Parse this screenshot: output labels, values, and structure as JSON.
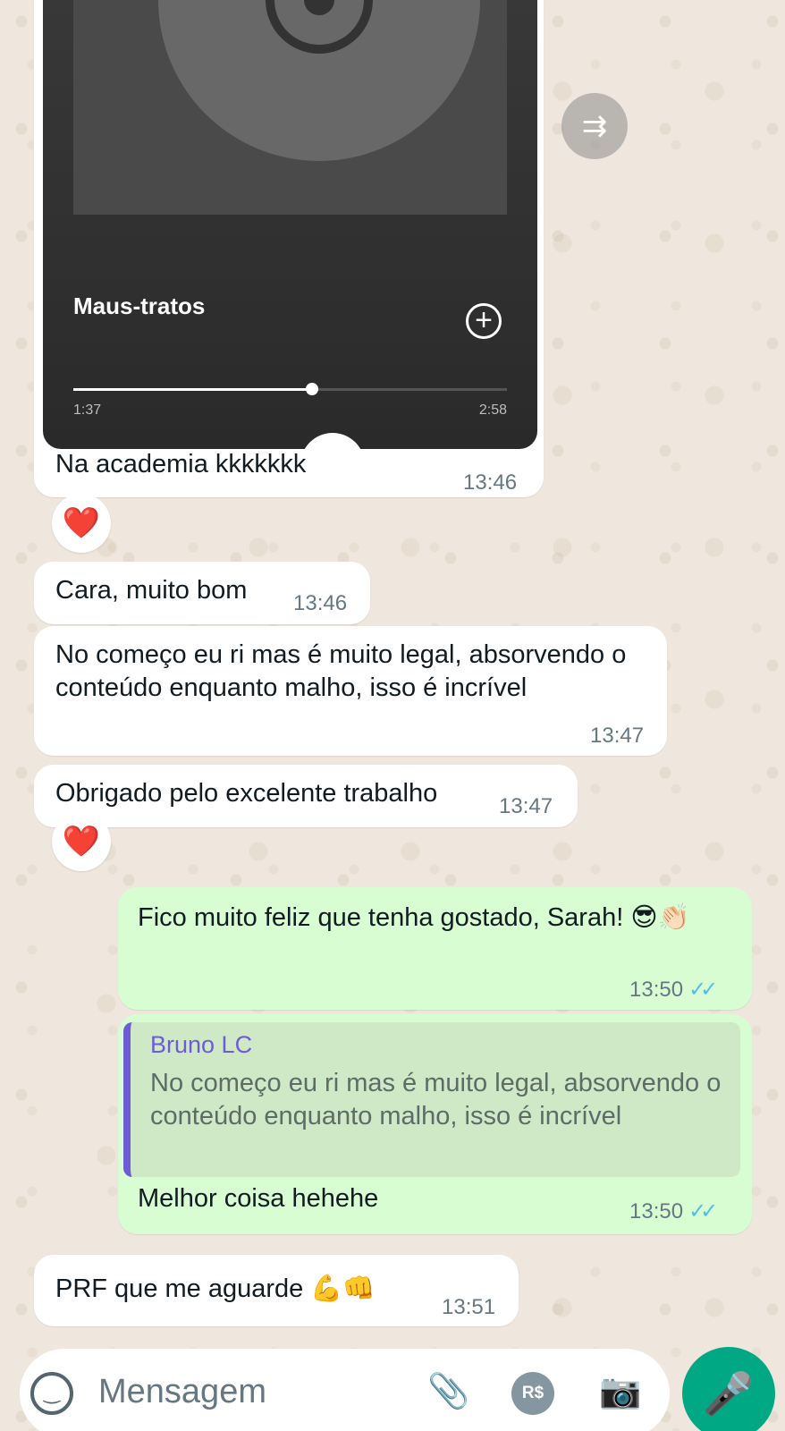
{
  "music": {
    "title": "Maus-tratos",
    "current_time": "1:37",
    "total_time": "2:58",
    "progress": 0.55
  },
  "messages": [
    {
      "id": "m1",
      "text": "Na academia kkkkkkk",
      "time": "13:46",
      "reaction": "❤️"
    },
    {
      "id": "m2",
      "text": "Cara, muito bom",
      "time": "13:46"
    },
    {
      "id": "m3",
      "text": "No começo eu ri mas é muito legal, absorvendo o conteúdo enquanto malho, isso é incrível",
      "time": "13:47"
    },
    {
      "id": "m4",
      "text": "Obrigado pelo excelente trabalho",
      "time": "13:47",
      "reaction": "❤️"
    },
    {
      "id": "m5",
      "text": "Fico muito feliz que tenha gostado, Sarah! 😎👏🏻",
      "time": "13:50",
      "outgoing": true
    },
    {
      "id": "m6",
      "quote_author": "Bruno LC",
      "quote_text": "No começo eu ri mas é muito legal, absorvendo o conteúdo enquanto malho, isso é incrível",
      "text": "Melhor coisa hehehe",
      "time": "13:50",
      "outgoing": true
    },
    {
      "id": "m7",
      "text": "PRF que me aguarde 💪👊",
      "time": "13:51"
    }
  ],
  "composer": {
    "placeholder": "Mensagem",
    "pay_label": "R$"
  },
  "icons": {
    "forward": "forward-icon",
    "emoji": "emoji-icon",
    "attach": "paperclip-icon",
    "pay": "payment-icon",
    "camera": "camera-icon",
    "mic": "microphone-icon",
    "read": "double-check-icon"
  },
  "colors": {
    "incoming_bubble": "#ffffff",
    "outgoing_bubble": "#d9fdd3",
    "accent": "#00a884",
    "quote_author": "#6e5bd6",
    "read_ticks": "#53bdeb"
  }
}
